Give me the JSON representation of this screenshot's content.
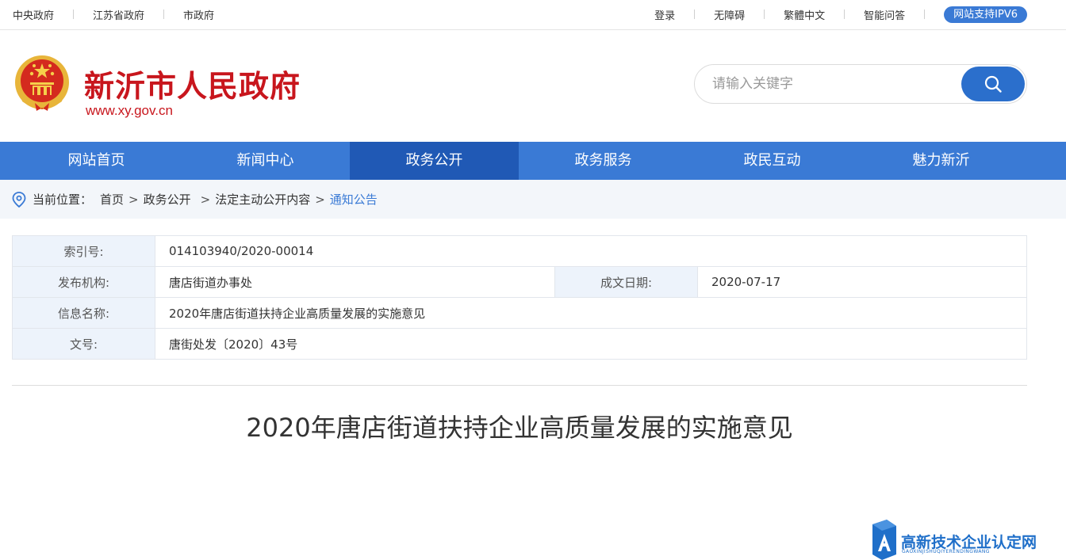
{
  "topbar": {
    "left_links": [
      "中央政府",
      "江苏省政府",
      "市政府"
    ],
    "right_links": [
      "登录",
      "无障碍",
      "繁體中文",
      "智能问答"
    ],
    "ipv6_badge": "网站支持IPV6"
  },
  "header": {
    "title": "新沂市人民政府",
    "url": "www.xy.gov.cn",
    "search_placeholder": "请输入关键字"
  },
  "nav": {
    "items": [
      "网站首页",
      "新闻中心",
      "政务公开",
      "政务服务",
      "政民互动",
      "魅力新沂"
    ],
    "active_index": 2
  },
  "breadcrumb": {
    "label": "当前位置：",
    "items": [
      "首页",
      "政务公开",
      "法定主动公开内容",
      "通知公告"
    ]
  },
  "info": {
    "index_label": "索引号:",
    "index_value": "014103940/2020-00014",
    "publisher_label": "发布机构:",
    "publisher_value": "唐店街道办事处",
    "date_label": "成文日期:",
    "date_value": "2020-07-17",
    "name_label": "信息名称:",
    "name_value": "2020年唐店街道扶持企业高质量发展的实施意见",
    "docno_label": "文号:",
    "docno_value": "唐街处发〔2020〕43号"
  },
  "article": {
    "title": "2020年唐店街道扶持企业高质量发展的实施意见"
  },
  "watermark": {
    "text": "高新技术企业认定网",
    "sub": "GAOXINJISHUQIYERENDINGWANG"
  },
  "colors": {
    "brand_red": "#c8161d",
    "nav_blue": "#3a7ad5",
    "nav_active": "#2059b5",
    "link_blue": "#3a7ad5"
  }
}
